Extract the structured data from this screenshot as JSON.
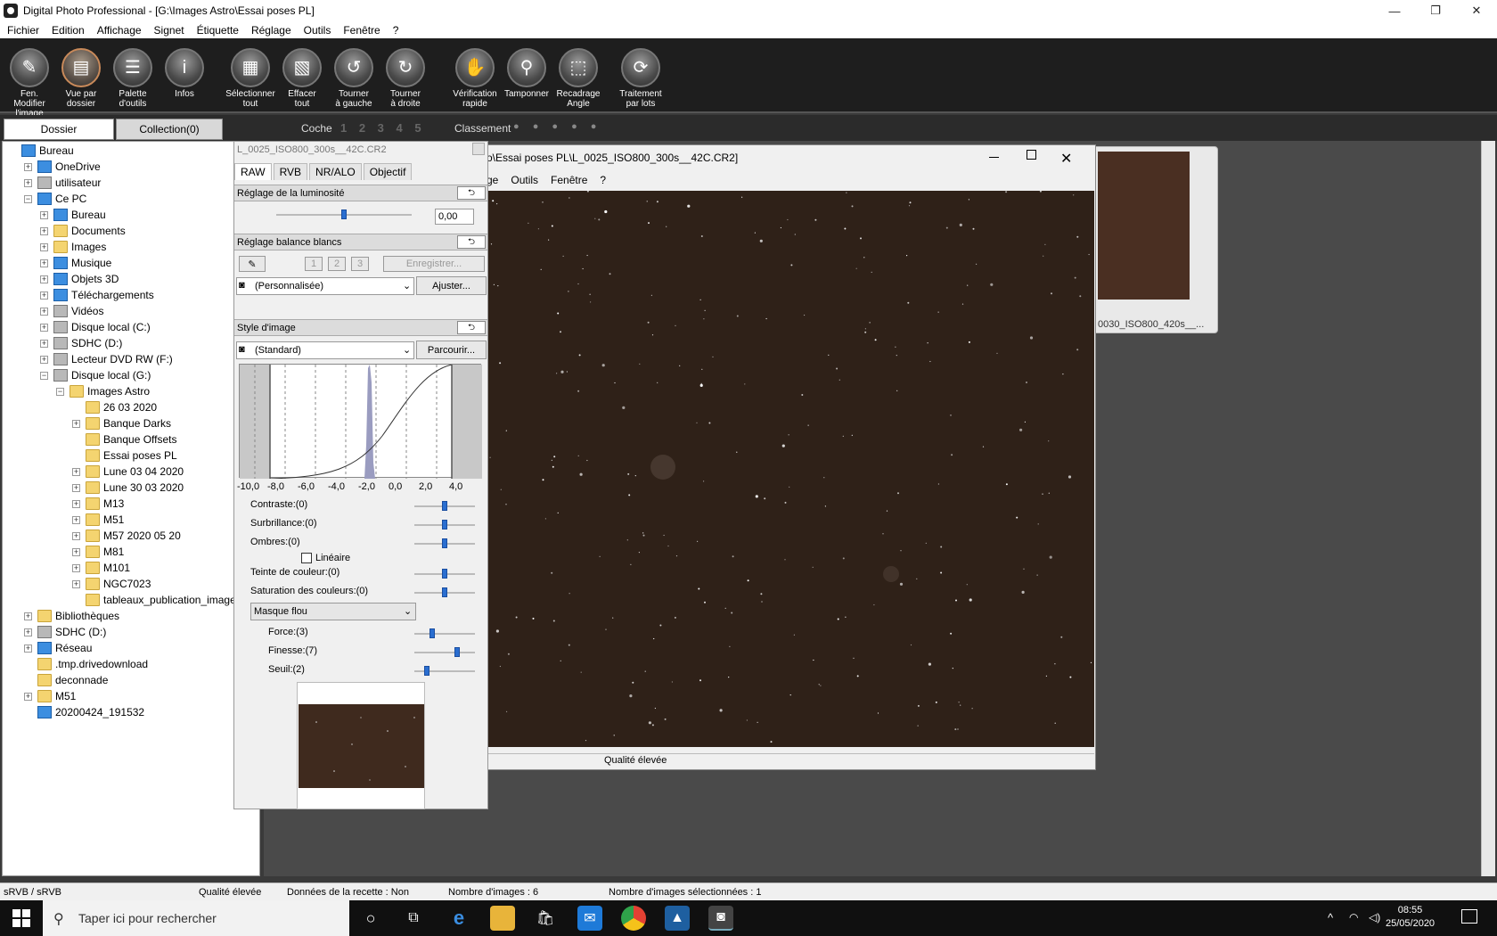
{
  "window": {
    "title": "Digital Photo Professional - [G:\\Images Astro\\Essai poses PL]",
    "controls": [
      "—",
      "❐",
      "✕"
    ]
  },
  "menubar": [
    "Fichier",
    "Edition",
    "Affichage",
    "Signet",
    "Étiquette",
    "Réglage",
    "Outils",
    "Fenêtre",
    "?"
  ],
  "toolbar": [
    {
      "l1": "Fen. Modifier",
      "l2": "l'image",
      "icon": "edit-window-icon",
      "glyph": "✎"
    },
    {
      "l1": "Vue par",
      "l2": "dossier",
      "icon": "folder-view-icon",
      "glyph": "▤"
    },
    {
      "l1": "Palette",
      "l2": "d'outils",
      "icon": "tool-palette-icon",
      "glyph": "☰"
    },
    {
      "l1": "Infos",
      "l2": "",
      "icon": "info-icon",
      "glyph": "i"
    },
    {
      "l1": "Sélectionner",
      "l2": "tout",
      "icon": "select-all-icon",
      "glyph": "▦"
    },
    {
      "l1": "Effacer",
      "l2": "tout",
      "icon": "clear-all-icon",
      "glyph": "▧"
    },
    {
      "l1": "Tourner",
      "l2": "à gauche",
      "icon": "rotate-left-icon",
      "glyph": "↺"
    },
    {
      "l1": "Tourner",
      "l2": "à droite",
      "icon": "rotate-right-icon",
      "glyph": "↻"
    },
    {
      "l1": "Vérification",
      "l2": "rapide",
      "icon": "quick-check-icon",
      "glyph": "✋"
    },
    {
      "l1": "Tamponner",
      "l2": "",
      "icon": "stamp-icon",
      "glyph": "⚲"
    },
    {
      "l1": "Recadrage",
      "l2": "Angle",
      "icon": "crop-angle-icon",
      "glyph": "⬚"
    },
    {
      "l1": "Traitement",
      "l2": "par lots",
      "icon": "batch-process-icon",
      "glyph": "⟳"
    }
  ],
  "panel_tabs": {
    "folder": "Dossier",
    "collection": "Collection(0)"
  },
  "filter": {
    "coche": "Coche",
    "coche_numbers": "1 2 3 4 5",
    "classement": "Classement",
    "stars": "● ● ● ● ●"
  },
  "tree": [
    {
      "label": "Bureau",
      "depth": 0,
      "exp": "",
      "icon": "desktop"
    },
    {
      "label": "OneDrive",
      "depth": 1,
      "exp": "+",
      "icon": "cloud"
    },
    {
      "label": "utilisateur",
      "depth": 1,
      "exp": "+",
      "icon": "user"
    },
    {
      "label": "Ce PC",
      "depth": 1,
      "exp": "−",
      "icon": "pc"
    },
    {
      "label": "Bureau",
      "depth": 2,
      "exp": "+",
      "icon": "desktop"
    },
    {
      "label": "Documents",
      "depth": 2,
      "exp": "+",
      "icon": "docs"
    },
    {
      "label": "Images",
      "depth": 2,
      "exp": "+",
      "icon": "images"
    },
    {
      "label": "Musique",
      "depth": 2,
      "exp": "+",
      "icon": "music"
    },
    {
      "label": "Objets 3D",
      "depth": 2,
      "exp": "+",
      "icon": "cube"
    },
    {
      "label": "Téléchargements",
      "depth": 2,
      "exp": "+",
      "icon": "download"
    },
    {
      "label": "Vidéos",
      "depth": 2,
      "exp": "+",
      "icon": "video"
    },
    {
      "label": "Disque local (C:)",
      "depth": 2,
      "exp": "+",
      "icon": "drive"
    },
    {
      "label": "SDHC (D:)",
      "depth": 2,
      "exp": "+",
      "icon": "sd"
    },
    {
      "label": "Lecteur DVD RW (F:)",
      "depth": 2,
      "exp": "+",
      "icon": "dvd"
    },
    {
      "label": "Disque local (G:)",
      "depth": 2,
      "exp": "−",
      "icon": "drive"
    },
    {
      "label": "Images Astro",
      "depth": 3,
      "exp": "−",
      "icon": "folder"
    },
    {
      "label": "26 03 2020",
      "depth": 4,
      "exp": "",
      "icon": "folder"
    },
    {
      "label": "Banque Darks",
      "depth": 4,
      "exp": "+",
      "icon": "folder"
    },
    {
      "label": "Banque Offsets",
      "depth": 4,
      "exp": "",
      "icon": "folder"
    },
    {
      "label": "Essai poses PL",
      "depth": 4,
      "exp": "",
      "icon": "folder"
    },
    {
      "label": "Lune 03 04 2020",
      "depth": 4,
      "exp": "+",
      "icon": "folder"
    },
    {
      "label": "Lune 30 03 2020",
      "depth": 4,
      "exp": "+",
      "icon": "folder"
    },
    {
      "label": "M13",
      "depth": 4,
      "exp": "+",
      "icon": "folder"
    },
    {
      "label": "M51",
      "depth": 4,
      "exp": "+",
      "icon": "folder"
    },
    {
      "label": "M57 2020 05 20",
      "depth": 4,
      "exp": "+",
      "icon": "folder"
    },
    {
      "label": "M81",
      "depth": 4,
      "exp": "+",
      "icon": "folder"
    },
    {
      "label": "M101",
      "depth": 4,
      "exp": "+",
      "icon": "folder"
    },
    {
      "label": "NGC7023",
      "depth": 4,
      "exp": "+",
      "icon": "folder"
    },
    {
      "label": "tableaux_publication_image",
      "depth": 4,
      "exp": "",
      "icon": "folder"
    },
    {
      "label": "Bibliothèques",
      "depth": 1,
      "exp": "+",
      "icon": "library"
    },
    {
      "label": "SDHC (D:)",
      "depth": 1,
      "exp": "+",
      "icon": "sd"
    },
    {
      "label": "Réseau",
      "depth": 1,
      "exp": "+",
      "icon": "network"
    },
    {
      "label": ".tmp.drivedownload",
      "depth": 1,
      "exp": "",
      "icon": "folder"
    },
    {
      "label": "deconnade",
      "depth": 1,
      "exp": "",
      "icon": "folder"
    },
    {
      "label": "M51",
      "depth": 1,
      "exp": "+",
      "icon": "folder"
    },
    {
      "label": "20200424_191532",
      "depth": 1,
      "exp": "",
      "icon": "file"
    }
  ],
  "thumbnail": {
    "name": "0030_ISO800_420s__..."
  },
  "viewer": {
    "title": "o\\Essai poses PL\\L_0025_ISO800_300s__42C.CR2]",
    "menu": [
      "ge",
      "Outils",
      "Fenêtre",
      "?"
    ],
    "status": "Qualité élevée"
  },
  "palette": {
    "title": "L_0025_ISO800_300s__42C.CR2",
    "tabs": [
      "RAW",
      "RVB",
      "NR/ALO",
      "Objectif"
    ],
    "brightness": {
      "label": "Réglage de la luminosité",
      "value": "0,00",
      "level": 0.5
    },
    "wb": {
      "label": "Réglage balance blancs",
      "slots": [
        "1",
        "2",
        "3"
      ],
      "save": "Enregistrer...",
      "preset": "(Personnalisée)",
      "adjust": "Ajuster..."
    },
    "style": {
      "label": "Style d'image",
      "value": "(Standard)",
      "browse": "Parcourir..."
    },
    "histo_ticks": [
      "-10,0",
      "-8,0",
      "-6,0",
      "-4,0",
      "-2,0",
      "0,0",
      "2,0",
      "4,0"
    ],
    "sliders": [
      {
        "label": "Contraste:(0)",
        "level": 0.5
      },
      {
        "label": "Surbrillance:(0)",
        "level": 0.5
      },
      {
        "label": "Ombres:(0)",
        "level": 0.5
      }
    ],
    "lineaire": "Linéaire",
    "sliders2": [
      {
        "label": "Teinte de couleur:(0)",
        "level": 0.5
      },
      {
        "label": "Saturation des couleurs:(0)",
        "level": 0.5
      }
    ],
    "sharpen_mode": "Masque flou",
    "sharpen": [
      {
        "label": "Force:(3)",
        "level": 0.3
      },
      {
        "label": "Finesse:(7)",
        "level": 0.7
      },
      {
        "label": "Seuil:(2)",
        "level": 0.2
      }
    ]
  },
  "statusbar": {
    "color": "sRVB / sRVB",
    "quality": "Qualité élevée",
    "recipe": "Données de la recette : Non",
    "count": "Nombre d'images : 6",
    "selected": "Nombre d'images sélectionnées : 1"
  },
  "taskbar": {
    "search": "Taper ici pour rechercher",
    "time": "08:55",
    "date": "25/05/2020"
  }
}
